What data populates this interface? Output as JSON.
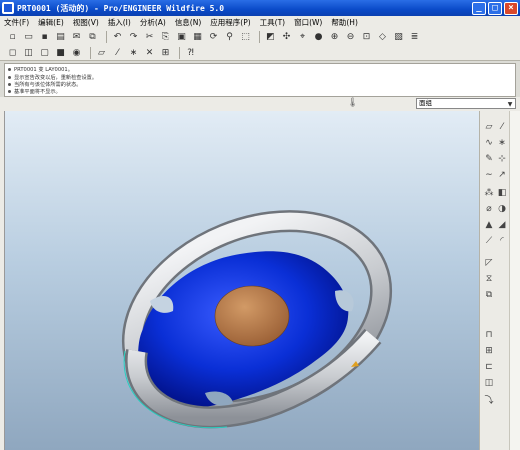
{
  "window": {
    "title": "PRT0001 (活动的) - Pro/ENGINEER Wildfire 5.0",
    "controls": {
      "minimize": "_",
      "maximize": "□",
      "close": "×"
    }
  },
  "menu": [
    "文件(F)",
    "编辑(E)",
    "视图(V)",
    "插入(I)",
    "分析(A)",
    "信息(N)",
    "应用程序(P)",
    "工具(T)",
    "窗口(W)",
    "帮助(H)"
  ],
  "messages": [
    "PRT0001 变 LAY0001。",
    "显示宣告改变以后，重新检查设置。",
    "当所有与该位体所需的状态。",
    "基准平面将不显示。"
  ],
  "filter": {
    "value": "面组"
  },
  "colors": {
    "hub_blue": "#0a2fd6",
    "wheel_gray": "#c9ccd0",
    "emblem_brown": "#b87a48",
    "viewport_top": "#e2ecf5",
    "viewport_bottom": "#8fa7bf"
  }
}
